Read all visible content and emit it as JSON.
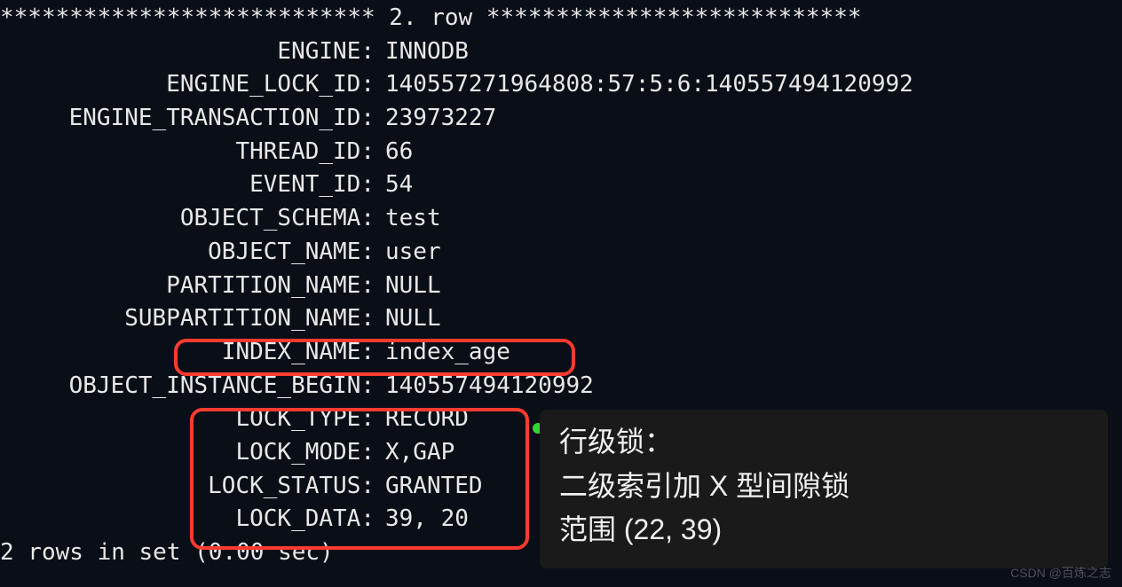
{
  "header": {
    "stars_left": "***************************",
    "row_label": " 2. row ",
    "stars_right": "***************************"
  },
  "fields": [
    {
      "label": "ENGINE:",
      "value": "INNODB"
    },
    {
      "label": "ENGINE_LOCK_ID:",
      "value": "140557271964808:57:5:6:140557494120992"
    },
    {
      "label": "ENGINE_TRANSACTION_ID:",
      "value": "23973227"
    },
    {
      "label": "THREAD_ID:",
      "value": "66"
    },
    {
      "label": "EVENT_ID:",
      "value": "54"
    },
    {
      "label": "OBJECT_SCHEMA:",
      "value": "test"
    },
    {
      "label": "OBJECT_NAME:",
      "value": "user"
    },
    {
      "label": "PARTITION_NAME:",
      "value": "NULL"
    },
    {
      "label": "SUBPARTITION_NAME:",
      "value": "NULL"
    },
    {
      "label": "INDEX_NAME:",
      "value": "index_age"
    },
    {
      "label": "OBJECT_INSTANCE_BEGIN:",
      "value": "140557494120992"
    },
    {
      "label": "LOCK_TYPE:",
      "value": "RECORD"
    },
    {
      "label": "LOCK_MODE:",
      "value": "X,GAP"
    },
    {
      "label": "LOCK_STATUS:",
      "value": "GRANTED"
    },
    {
      "label": "LOCK_DATA:",
      "value": "39, 20"
    }
  ],
  "footer": "2 rows in set (0.00 sec)",
  "annotation": {
    "line1": "行级锁：",
    "line2": "二级索引加 X 型间隙锁",
    "line3": "范围 (22, 39)"
  },
  "watermark": "CSDN @百炼之志"
}
